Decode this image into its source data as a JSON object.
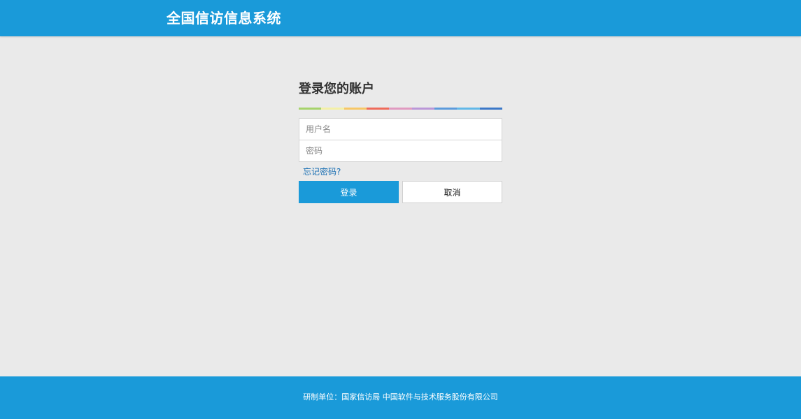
{
  "header": {
    "title": "全国信访信息系统"
  },
  "login": {
    "title": "登录您的账户",
    "color_bar": [
      "#a6d36b",
      "#f4f0a6",
      "#f7c766",
      "#ef6b5a",
      "#e09ac0",
      "#bb97d8",
      "#5c9bdc",
      "#62b8e8",
      "#3b78c8"
    ],
    "username": {
      "value": "",
      "placeholder": "用户名"
    },
    "password": {
      "value": "",
      "placeholder": "密码"
    },
    "forgot_label": "忘记密码?",
    "login_label": "登录",
    "cancel_label": "取消"
  },
  "footer": {
    "text": "研制单位：国家信访局  中国软件与技术服务股份有限公司"
  },
  "colors": {
    "brand": "#1a9ad9",
    "background": "#eaeaea",
    "link": "#1a6fb3"
  }
}
